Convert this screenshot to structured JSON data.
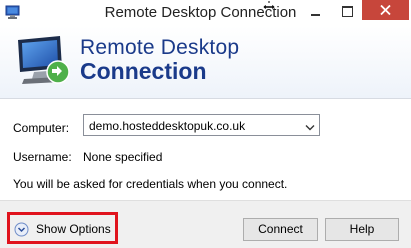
{
  "window": {
    "title": "Remote Desktop Connection"
  },
  "banner": {
    "line1": "Remote Desktop",
    "line2": "Connection"
  },
  "form": {
    "computer_label": "Computer:",
    "computer_value": "demo.hosteddesktopuk.co.uk",
    "username_label": "Username:",
    "username_value": "None specified",
    "credentials_note": "You will be asked for credentials when you connect."
  },
  "footer": {
    "show_options_label": "Show Options",
    "connect_label": "Connect",
    "help_label": "Help"
  },
  "colors": {
    "banner_text": "#1a3a8a",
    "close_button": "#c7463b",
    "highlight_border": "#e0131d"
  },
  "icons": {
    "window": "remote-desktop-icon",
    "banner": "remote-desktop-monitor-icon",
    "show_options": "chevron-down-circle-icon",
    "combo": "chevron-down-icon",
    "close": "close-icon"
  }
}
